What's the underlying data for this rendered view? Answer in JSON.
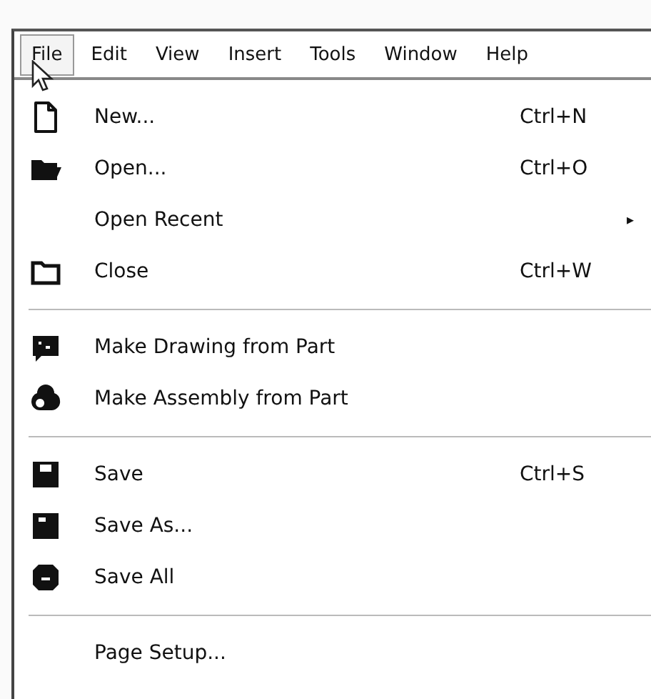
{
  "menubar": [
    {
      "label": "File",
      "selected": true
    },
    {
      "label": "Edit",
      "selected": false
    },
    {
      "label": "View",
      "selected": false
    },
    {
      "label": "Insert",
      "selected": false
    },
    {
      "label": "Tools",
      "selected": false
    },
    {
      "label": "Window",
      "selected": false
    },
    {
      "label": "Help",
      "selected": false
    }
  ],
  "menu": [
    {
      "kind": "item",
      "label": "New...",
      "shortcut": "Ctrl+N"
    },
    {
      "kind": "item",
      "label": "Open...",
      "shortcut": "Ctrl+O"
    },
    {
      "kind": "submenu",
      "label": "Open Recent",
      "arrow": "▸"
    },
    {
      "kind": "item",
      "label": "Close",
      "shortcut": "Ctrl+W"
    },
    {
      "kind": "separator"
    },
    {
      "kind": "item",
      "label": "Make Drawing from Part"
    },
    {
      "kind": "item",
      "label": "Make Assembly from Part"
    },
    {
      "kind": "separator"
    },
    {
      "kind": "item",
      "label": "Save",
      "shortcut": "Ctrl+S"
    },
    {
      "kind": "item",
      "label": "Save As..."
    },
    {
      "kind": "item",
      "label": "Save All"
    },
    {
      "kind": "separator"
    },
    {
      "kind": "item",
      "label": "Page Setup..."
    }
  ]
}
